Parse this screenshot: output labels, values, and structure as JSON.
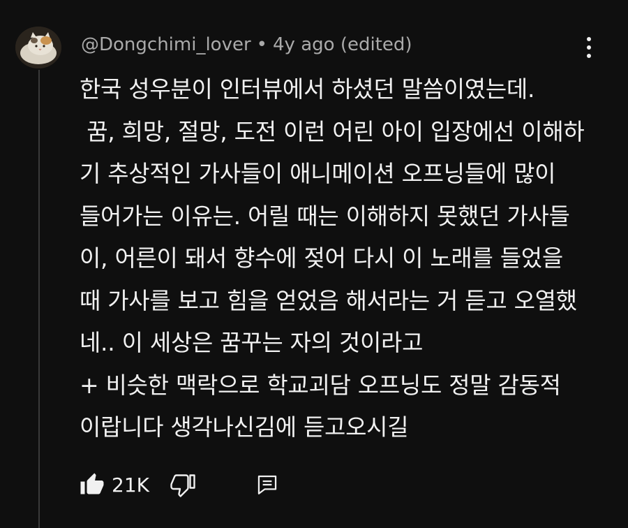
{
  "comment": {
    "author": "@Dongchimi_lover",
    "separator": "•",
    "timestamp": "4y ago (edited)",
    "lines": [
      "한국 성우분이 인터뷰에서 하셨던 말씀이였는데.",
      " 꿈, 희망, 절망, 도전 이런 어린 아이 입장에선 이해하",
      "기 추상적인 가사들이 애니메이션 오프닝들에 많이",
      "들어가는 이유는. 어릴 때는 이해하지 못했던 가사들",
      "이, 어른이 돼서 향수에 젖어 다시 이 노래를 들었을",
      "때 가사를 보고 힘을 얻었음 해서라는 거 듣고 오열했",
      "네.. 이 세상은 꿈꾸는 자의 것이라고",
      "+ 비슷한 맥락으로 학교괴담 오프닝도 정말 감동적",
      "이랍니다 생각나신김에 듣고오시길"
    ],
    "like_count": "21K"
  },
  "icons": {
    "avatar": "cat-avatar",
    "more": "more-vert-icon",
    "like": "thumbs-up-icon",
    "dislike": "thumbs-down-icon",
    "reply": "reply-icon"
  },
  "colors": {
    "background": "#0f0f0f",
    "text_primary": "#f1f1f1",
    "text_secondary": "#aaaaaa"
  }
}
